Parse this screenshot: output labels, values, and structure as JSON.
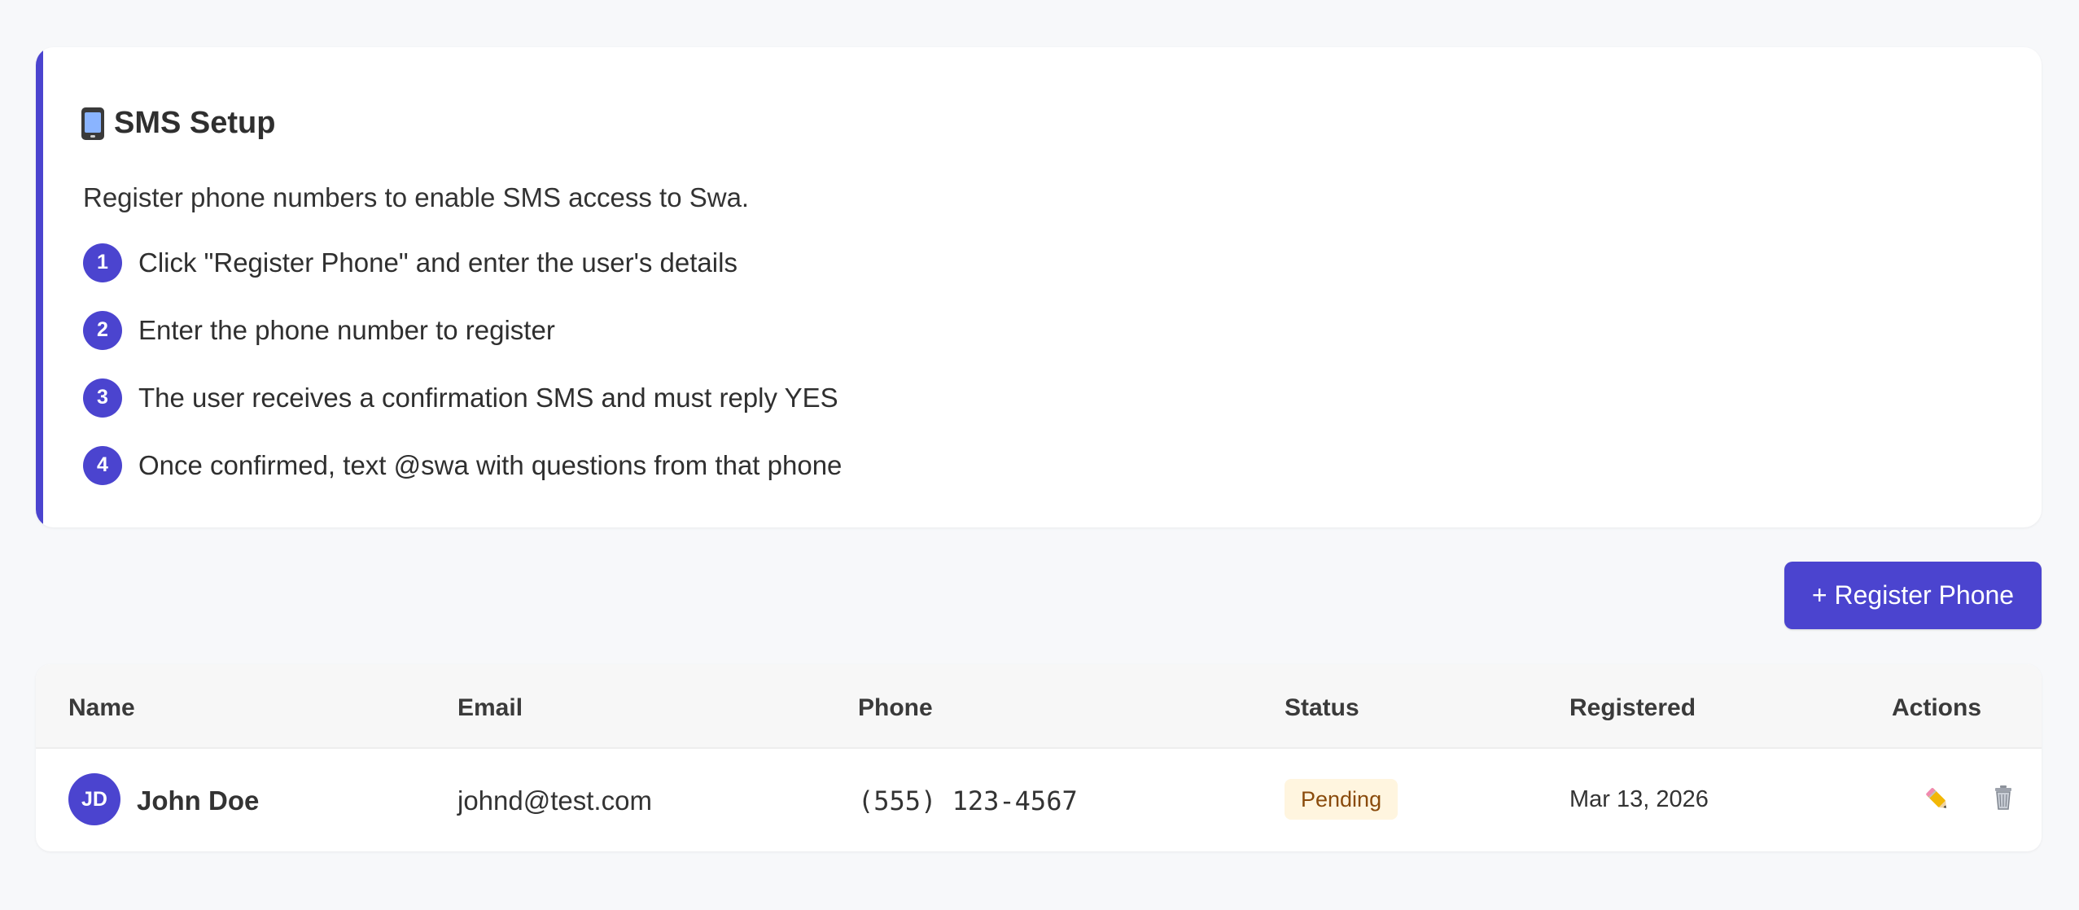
{
  "setup": {
    "title": "SMS Setup",
    "description": "Register phone numbers to enable SMS access to Swa.",
    "icon": "mobile-phone-icon",
    "steps": [
      {
        "number": "1",
        "text": "Click \"Register Phone\" and enter the user's details"
      },
      {
        "number": "2",
        "text": "Enter the phone number to register"
      },
      {
        "number": "3",
        "text": "The user receives a confirmation SMS and must reply YES"
      },
      {
        "number": "4",
        "text": "Once confirmed, text @swa with questions from that phone"
      }
    ]
  },
  "actions": {
    "register_phone_label": "+ Register Phone"
  },
  "table": {
    "headers": {
      "name": "Name",
      "email": "Email",
      "phone": "Phone",
      "status": "Status",
      "registered": "Registered",
      "actions": "Actions"
    },
    "rows": [
      {
        "initials": "JD",
        "name": "John Doe",
        "email": "johnd@test.com",
        "phone": "(555) 123-4567",
        "status": "Pending",
        "registered": "Mar 13, 2026",
        "edit_icon": "pencil-icon",
        "delete_icon": "trash-icon"
      }
    ]
  },
  "colors": {
    "accent": "#4b44cf",
    "pending_background": "#fff5df",
    "pending_text": "#8a4b0c"
  }
}
